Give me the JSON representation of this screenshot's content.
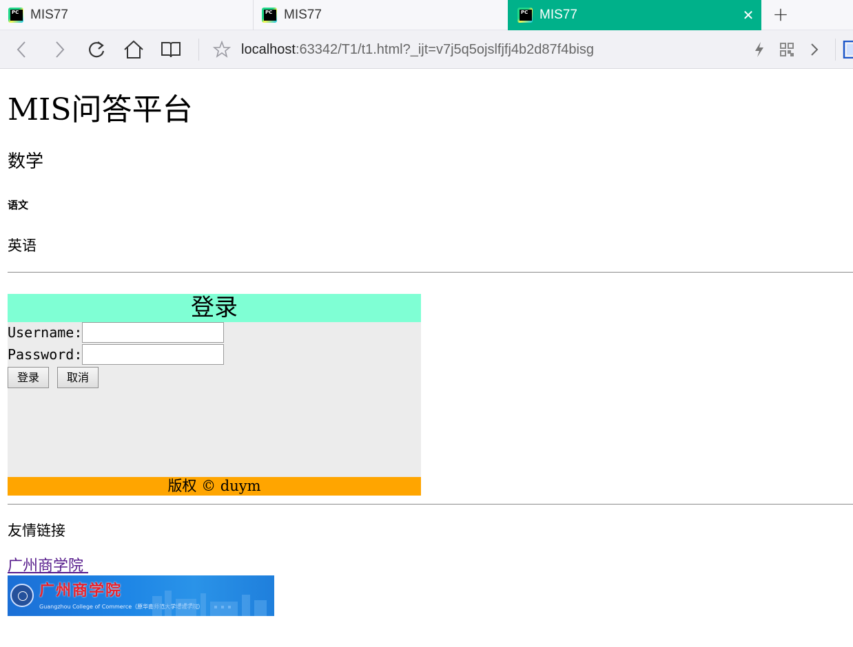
{
  "browser": {
    "tabs": [
      {
        "label": "MIS77",
        "active": false
      },
      {
        "label": "MIS77",
        "active": false
      },
      {
        "label": "MIS77",
        "active": true
      }
    ],
    "active_tab_color": "#00b18a",
    "close_icon": "✕",
    "new_tab_icon": "+",
    "address": {
      "host": "localhost",
      "rest": ":63342/T1/t1.html?_ijt=v7j5q5ojslfjfj4b2d87f4bisg"
    },
    "icons": [
      "back-icon",
      "forward-icon",
      "reload-icon",
      "home-icon",
      "reading-view-icon",
      "favorite-star-icon",
      "lightning-icon",
      "qr-code-icon",
      "chevron-right-icon",
      "extension-icon"
    ]
  },
  "page": {
    "title": "MIS问答平台",
    "heading_math": "数学",
    "heading_chinese": "语文",
    "paragraph_english": "英语",
    "login": {
      "header": "登录",
      "header_color": "#7fffd4",
      "body_color": "#ececec",
      "username_label": "Username:",
      "username_value": "",
      "password_label": "Password:",
      "password_value": "",
      "login_button": "登录",
      "cancel_button": "取消",
      "footer": "版权 © duym",
      "footer_color": "#ffa500"
    },
    "friend_links_label": "友情链接",
    "link_gcc": "广州商学院 ",
    "banner": {
      "logo_cn": "广州商学院",
      "logo_en": "Guangzhou College of Commerce（原华南师范大学增城学院）"
    }
  }
}
